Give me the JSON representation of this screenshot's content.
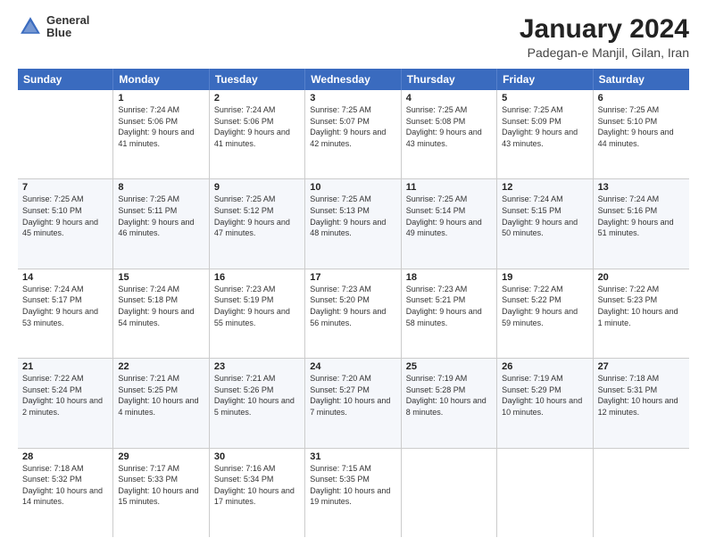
{
  "header": {
    "logo_line1": "General",
    "logo_line2": "Blue",
    "main_title": "January 2024",
    "subtitle": "Padegan-e Manjil, Gilan, Iran"
  },
  "calendar": {
    "weekdays": [
      "Sunday",
      "Monday",
      "Tuesday",
      "Wednesday",
      "Thursday",
      "Friday",
      "Saturday"
    ],
    "rows": [
      [
        {
          "day": "",
          "sunrise": "",
          "sunset": "",
          "daylight": ""
        },
        {
          "day": "1",
          "sunrise": "Sunrise: 7:24 AM",
          "sunset": "Sunset: 5:06 PM",
          "daylight": "Daylight: 9 hours and 41 minutes."
        },
        {
          "day": "2",
          "sunrise": "Sunrise: 7:24 AM",
          "sunset": "Sunset: 5:06 PM",
          "daylight": "Daylight: 9 hours and 41 minutes."
        },
        {
          "day": "3",
          "sunrise": "Sunrise: 7:25 AM",
          "sunset": "Sunset: 5:07 PM",
          "daylight": "Daylight: 9 hours and 42 minutes."
        },
        {
          "day": "4",
          "sunrise": "Sunrise: 7:25 AM",
          "sunset": "Sunset: 5:08 PM",
          "daylight": "Daylight: 9 hours and 43 minutes."
        },
        {
          "day": "5",
          "sunrise": "Sunrise: 7:25 AM",
          "sunset": "Sunset: 5:09 PM",
          "daylight": "Daylight: 9 hours and 43 minutes."
        },
        {
          "day": "6",
          "sunrise": "Sunrise: 7:25 AM",
          "sunset": "Sunset: 5:10 PM",
          "daylight": "Daylight: 9 hours and 44 minutes."
        }
      ],
      [
        {
          "day": "7",
          "sunrise": "Sunrise: 7:25 AM",
          "sunset": "Sunset: 5:10 PM",
          "daylight": "Daylight: 9 hours and 45 minutes."
        },
        {
          "day": "8",
          "sunrise": "Sunrise: 7:25 AM",
          "sunset": "Sunset: 5:11 PM",
          "daylight": "Daylight: 9 hours and 46 minutes."
        },
        {
          "day": "9",
          "sunrise": "Sunrise: 7:25 AM",
          "sunset": "Sunset: 5:12 PM",
          "daylight": "Daylight: 9 hours and 47 minutes."
        },
        {
          "day": "10",
          "sunrise": "Sunrise: 7:25 AM",
          "sunset": "Sunset: 5:13 PM",
          "daylight": "Daylight: 9 hours and 48 minutes."
        },
        {
          "day": "11",
          "sunrise": "Sunrise: 7:25 AM",
          "sunset": "Sunset: 5:14 PM",
          "daylight": "Daylight: 9 hours and 49 minutes."
        },
        {
          "day": "12",
          "sunrise": "Sunrise: 7:24 AM",
          "sunset": "Sunset: 5:15 PM",
          "daylight": "Daylight: 9 hours and 50 minutes."
        },
        {
          "day": "13",
          "sunrise": "Sunrise: 7:24 AM",
          "sunset": "Sunset: 5:16 PM",
          "daylight": "Daylight: 9 hours and 51 minutes."
        }
      ],
      [
        {
          "day": "14",
          "sunrise": "Sunrise: 7:24 AM",
          "sunset": "Sunset: 5:17 PM",
          "daylight": "Daylight: 9 hours and 53 minutes."
        },
        {
          "day": "15",
          "sunrise": "Sunrise: 7:24 AM",
          "sunset": "Sunset: 5:18 PM",
          "daylight": "Daylight: 9 hours and 54 minutes."
        },
        {
          "day": "16",
          "sunrise": "Sunrise: 7:23 AM",
          "sunset": "Sunset: 5:19 PM",
          "daylight": "Daylight: 9 hours and 55 minutes."
        },
        {
          "day": "17",
          "sunrise": "Sunrise: 7:23 AM",
          "sunset": "Sunset: 5:20 PM",
          "daylight": "Daylight: 9 hours and 56 minutes."
        },
        {
          "day": "18",
          "sunrise": "Sunrise: 7:23 AM",
          "sunset": "Sunset: 5:21 PM",
          "daylight": "Daylight: 9 hours and 58 minutes."
        },
        {
          "day": "19",
          "sunrise": "Sunrise: 7:22 AM",
          "sunset": "Sunset: 5:22 PM",
          "daylight": "Daylight: 9 hours and 59 minutes."
        },
        {
          "day": "20",
          "sunrise": "Sunrise: 7:22 AM",
          "sunset": "Sunset: 5:23 PM",
          "daylight": "Daylight: 10 hours and 1 minute."
        }
      ],
      [
        {
          "day": "21",
          "sunrise": "Sunrise: 7:22 AM",
          "sunset": "Sunset: 5:24 PM",
          "daylight": "Daylight: 10 hours and 2 minutes."
        },
        {
          "day": "22",
          "sunrise": "Sunrise: 7:21 AM",
          "sunset": "Sunset: 5:25 PM",
          "daylight": "Daylight: 10 hours and 4 minutes."
        },
        {
          "day": "23",
          "sunrise": "Sunrise: 7:21 AM",
          "sunset": "Sunset: 5:26 PM",
          "daylight": "Daylight: 10 hours and 5 minutes."
        },
        {
          "day": "24",
          "sunrise": "Sunrise: 7:20 AM",
          "sunset": "Sunset: 5:27 PM",
          "daylight": "Daylight: 10 hours and 7 minutes."
        },
        {
          "day": "25",
          "sunrise": "Sunrise: 7:19 AM",
          "sunset": "Sunset: 5:28 PM",
          "daylight": "Daylight: 10 hours and 8 minutes."
        },
        {
          "day": "26",
          "sunrise": "Sunrise: 7:19 AM",
          "sunset": "Sunset: 5:29 PM",
          "daylight": "Daylight: 10 hours and 10 minutes."
        },
        {
          "day": "27",
          "sunrise": "Sunrise: 7:18 AM",
          "sunset": "Sunset: 5:31 PM",
          "daylight": "Daylight: 10 hours and 12 minutes."
        }
      ],
      [
        {
          "day": "28",
          "sunrise": "Sunrise: 7:18 AM",
          "sunset": "Sunset: 5:32 PM",
          "daylight": "Daylight: 10 hours and 14 minutes."
        },
        {
          "day": "29",
          "sunrise": "Sunrise: 7:17 AM",
          "sunset": "Sunset: 5:33 PM",
          "daylight": "Daylight: 10 hours and 15 minutes."
        },
        {
          "day": "30",
          "sunrise": "Sunrise: 7:16 AM",
          "sunset": "Sunset: 5:34 PM",
          "daylight": "Daylight: 10 hours and 17 minutes."
        },
        {
          "day": "31",
          "sunrise": "Sunrise: 7:15 AM",
          "sunset": "Sunset: 5:35 PM",
          "daylight": "Daylight: 10 hours and 19 minutes."
        },
        {
          "day": "",
          "sunrise": "",
          "sunset": "",
          "daylight": ""
        },
        {
          "day": "",
          "sunrise": "",
          "sunset": "",
          "daylight": ""
        },
        {
          "day": "",
          "sunrise": "",
          "sunset": "",
          "daylight": ""
        }
      ]
    ]
  }
}
